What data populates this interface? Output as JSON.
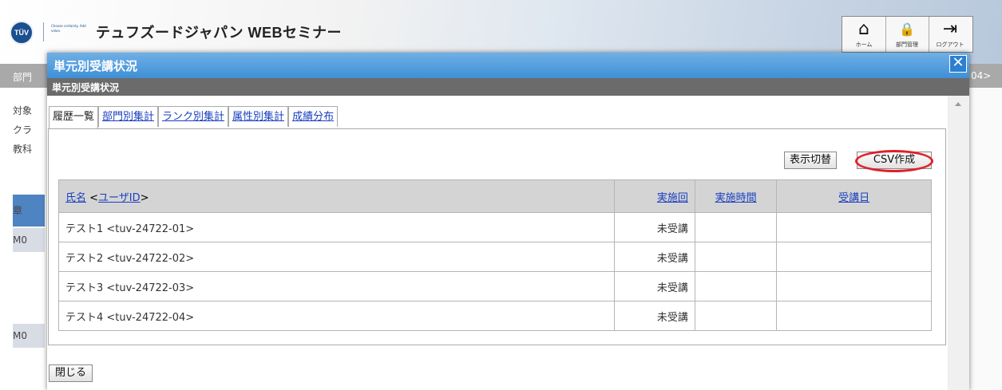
{
  "site": {
    "title": "テュフズードジャパン WEBセミナー",
    "logo_text": "TÜV",
    "tagline": "Choose certainty. Add value."
  },
  "topnav": [
    {
      "icon": "home-icon",
      "glyph": "⌂",
      "label": "ホーム"
    },
    {
      "icon": "lock-user-icon",
      "glyph": "🔒",
      "label": "部門管理"
    },
    {
      "icon": "logout-icon",
      "glyph": "⇥",
      "label": "ログアウト"
    }
  ],
  "background": {
    "left_labels": [
      "部門",
      "対象",
      "クラ",
      "教科",
      "章",
      "M0",
      "M0"
    ],
    "right_text": "04>"
  },
  "dialog": {
    "title": "単元別受講状況",
    "subtitle": "単元別受講状況",
    "close_glyph": "✕",
    "close_button": "閉じる"
  },
  "tabs": [
    {
      "label": "履歴一覧",
      "active": true
    },
    {
      "label": "部門別集計",
      "active": false
    },
    {
      "label": "ランク別集計",
      "active": false
    },
    {
      "label": "属性別集計",
      "active": false
    },
    {
      "label": "成績分布",
      "active": false
    }
  ],
  "toolbar": {
    "toggle_view": "表示切替",
    "csv": "CSV作成"
  },
  "table": {
    "headers": {
      "name_link": "氏名",
      "name_sep": " <",
      "userid_link": "ユーザID",
      "name_end": ">",
      "round": "実施回",
      "time": "実施時間",
      "date": "受講日"
    },
    "rows": [
      {
        "name": "テスト1 <tuv-24722-01>",
        "round": "未受講",
        "time": "",
        "date": ""
      },
      {
        "name": "テスト2 <tuv-24722-02>",
        "round": "未受講",
        "time": "",
        "date": ""
      },
      {
        "name": "テスト3 <tuv-24722-03>",
        "round": "未受講",
        "time": "",
        "date": ""
      },
      {
        "name": "テスト4 <tuv-24722-04>",
        "round": "未受講",
        "time": "",
        "date": ""
      }
    ]
  },
  "colors": {
    "title_bar": "#3f8fd6",
    "csv_highlight": "#e0202a",
    "status_red": "#d0201f"
  }
}
